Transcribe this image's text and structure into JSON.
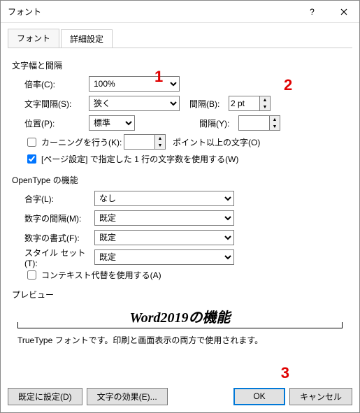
{
  "titlebar": {
    "title": "フォント"
  },
  "tabs": {
    "font": "フォント",
    "advanced": "詳細設定"
  },
  "section_spacing": "文字幅と間隔",
  "scale": {
    "label": "倍率(C):",
    "value": "100%"
  },
  "spacing": {
    "label": "文字間隔(S):",
    "value": "狭く",
    "label2": "間隔(B):",
    "value2": "2 pt"
  },
  "position": {
    "label": "位置(P):",
    "value": "標準",
    "label2": "間隔(Y):",
    "value2": ""
  },
  "kerning": {
    "label": "カーニングを行う(K):",
    "unit": "ポイント以上の文字(O)"
  },
  "pagesetup": {
    "label": "[ページ設定] で指定した 1 行の文字数を使用する(W)"
  },
  "section_opentype": "OpenType の機能",
  "ligature": {
    "label": "合字(L):",
    "value": "なし"
  },
  "numspacing": {
    "label": "数字の間隔(M):",
    "value": "既定"
  },
  "numform": {
    "label": "数字の書式(F):",
    "value": "既定"
  },
  "styleset": {
    "label": "スタイル セット(T):",
    "value": "既定"
  },
  "context": {
    "label": "コンテキスト代替を使用する(A)"
  },
  "section_preview": "プレビュー",
  "preview": {
    "text": "Word2019の機能"
  },
  "note": "TrueType フォントです。印刷と画面表示の両方で使用されます。",
  "buttons": {
    "default": "既定に設定(D)",
    "effects": "文字の効果(E)...",
    "ok": "OK",
    "cancel": "キャンセル"
  },
  "annotations": {
    "a1": "1",
    "a2": "2",
    "a3": "3"
  }
}
